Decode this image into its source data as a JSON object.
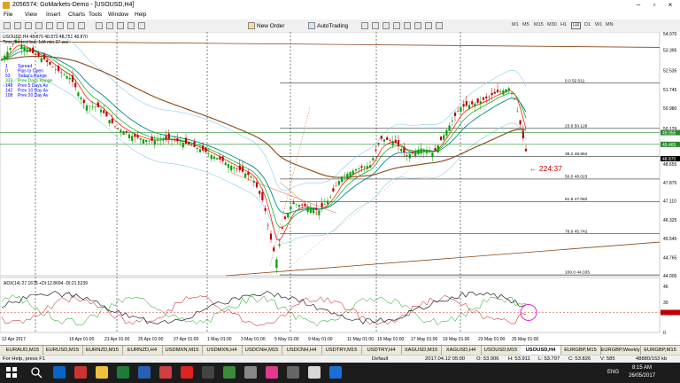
{
  "window": {
    "title": "2056574: GoMarkets-Demo - [USOUSD,H4]"
  },
  "menu": [
    "File",
    "View",
    "Insert",
    "Charts",
    "Tools",
    "Window",
    "Help"
  ],
  "toolbar": {
    "new_order": "New Order",
    "autotrading": "AutoTrading",
    "timeframes": [
      "M1",
      "M5",
      "M15",
      "M30",
      "H1",
      "H4",
      "D1",
      "W1",
      "MN"
    ],
    "active_timeframe": "H4"
  },
  "chart": {
    "header": "USOUSD,H4  48.870 48.870 48.751 48.870",
    "time_for_next_bar": "Time for next bar: 1d4 min 37 sec",
    "legend": [
      {
        "num": "1",
        "label": "Spread",
        "color": "#0000ff"
      },
      {
        "num": "0",
        "label": "Pips to Open",
        "color": "#0000ff"
      },
      {
        "num": "53",
        "label": "Today's Range",
        "color": "#0000ff"
      },
      {
        "num": "333",
        "label": "Prev Days Range",
        "color": "#009900"
      },
      {
        "num": "148",
        "label": "Prev 5 Days Av",
        "color": "#0000ff"
      },
      {
        "num": "142",
        "label": "Prev 10 Day Av",
        "color": "#0000ff"
      },
      {
        "num": "108",
        "label": "Prev 20 Day Av",
        "color": "#0000ff"
      }
    ],
    "countdown": "← 224:37",
    "price_axis": [
      "54.070",
      "53.395",
      "52.535",
      "51.745",
      "50.980",
      "50.129",
      "49.465",
      "48.870",
      "48.655",
      "47.875",
      "47.110",
      "46.325",
      "45.545",
      "44.765",
      "44.005"
    ],
    "current_price_labels": [
      "49.955",
      "49.465",
      "48.870"
    ],
    "fib_levels": [
      {
        "label": "0.0  52.011",
        "value": 52.011
      },
      {
        "label": "23.6  50.129",
        "value": 50.129
      },
      {
        "label": "38.2  48.964",
        "value": 48.964
      },
      {
        "label": "50.0  48.023",
        "value": 48.023
      },
      {
        "label": "61.8  47.082",
        "value": 47.082
      },
      {
        "label": "78.6  45.742",
        "value": 45.742
      },
      {
        "label": "100.0  44.035",
        "value": 44.035
      }
    ],
    "adx_header": "ADX(14) 27.1678 +DI:12.8694 -DI:21.5239",
    "adx_axis": [
      "46",
      "30",
      "20",
      "0"
    ],
    "time_axis": [
      "12 Apr 2017",
      "19 Apr 01:00",
      "21 Apr 01:00",
      "25 Apr 01:00",
      "27 Apr 01:00",
      "1 May 01:00",
      "3 May 01:00",
      "5 May 01:00",
      "9 May 01:00",
      "11 May 01:00",
      "15 May 01:00",
      "17 May 01:00",
      "19 May 01:00",
      "23 May 01:00",
      "25 May 01:00"
    ]
  },
  "tabs": [
    "EURAUD,M15",
    "EURUSD,M15",
    "EURNZD,M15",
    "EURNZD,H4",
    "USDMXN,M15",
    "USDMXN,H4",
    "USDCNH,M15",
    "USDCNH,H4",
    "USDTRY,M15",
    "USDTRY,H4",
    "XAGUSD,M15",
    "XAGUSD,H4",
    "USOUSD,M15",
    "USOUSD,H4",
    "EURGBP,M15",
    "EURGBP,Weekly",
    "EURGBP,M15"
  ],
  "active_tab": "USOUSD,H4",
  "status": {
    "help": "For Help, press F1",
    "profile": "Default",
    "datetime": "2017.04.12 05:00",
    "open": "O: 53.906",
    "high": "H: 53.911",
    "low": "L: 53.797",
    "close": "C: 53.826",
    "volume": "V: 585",
    "traffic": "48880/153 kb"
  },
  "taskbar": {
    "time": "8:15 AM",
    "date": "26/05/2017",
    "lang": "ENG"
  },
  "colors": {
    "bull": "#00a000",
    "bear": "#c00000",
    "ma_fast": "#ff0000",
    "ma_mid": "#00aa00",
    "ma_teal": "#008b8b",
    "ma_slow": "#8b4513",
    "bb": "#87ceeb",
    "fib": "#808080"
  }
}
